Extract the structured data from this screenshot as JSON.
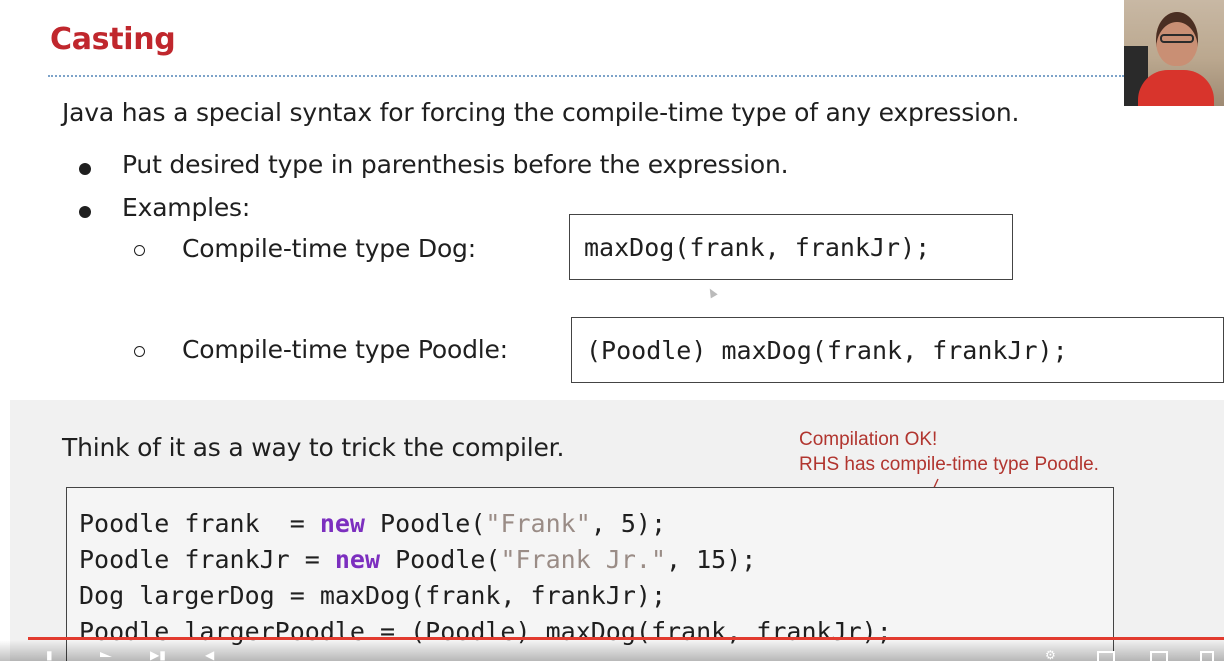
{
  "slide": {
    "title": "Casting",
    "intro": "Java has a special syntax for forcing the compile-time type of any expression.",
    "bullets": [
      "Put desired type in parenthesis before the expression.",
      "Examples:"
    ],
    "examples": [
      {
        "label": "Compile-time type Dog:",
        "code": "maxDog(frank, frankJr);"
      },
      {
        "label": "Compile-time type Poodle:",
        "code": "(Poodle) maxDog(frank, frankJr);"
      }
    ],
    "trick_text": "Think of it as a way to trick the compiler.",
    "annotation": {
      "line1": "Compilation OK!",
      "line2": "RHS has compile-time type Poodle."
    },
    "code_lines": {
      "l1_a": "Poodle frank  = ",
      "l1_kw": "new",
      "l1_b": " Poodle(",
      "l1_str": "\"Frank\"",
      "l1_c": ", 5);",
      "l2_a": "Poodle frankJr = ",
      "l2_kw": "new",
      "l2_b": " Poodle(",
      "l2_str": "\"Frank Jr.\"",
      "l2_c": ", 15);",
      "l3": "Dog largerDog = maxDog(frank, frankJr);",
      "l4": "Poodle largerPoodle = (Poodle) maxDog(frank, frankJr);"
    }
  },
  "colors": {
    "title": "#c0272d",
    "keyword": "#7c2fbf",
    "string": "#9a8c86",
    "annotation": "#b1352f",
    "progress": "#e23b2f"
  },
  "player": {
    "icons": [
      "skip-back-icon",
      "play-icon",
      "skip-next-icon",
      "volume-icon",
      "settings-icon",
      "miniplayer-icon",
      "theater-icon",
      "fullscreen-icon"
    ]
  }
}
